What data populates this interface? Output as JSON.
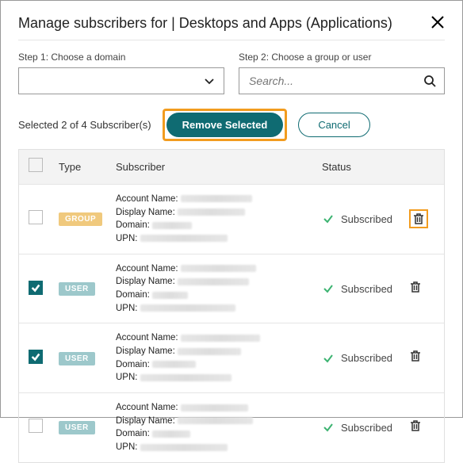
{
  "header": {
    "title": "Manage subscribers for | Desktops and Apps (Applications)"
  },
  "steps": {
    "domain_label": "Step 1: Choose a domain",
    "search_label": "Step 2: Choose a group or user",
    "search_placeholder": "Search..."
  },
  "actions": {
    "selected_text": "Selected 2 of 4 Subscriber(s)",
    "remove_label": "Remove Selected",
    "cancel_label": "Cancel"
  },
  "columns": {
    "type": "Type",
    "subscriber": "Subscriber",
    "status": "Status"
  },
  "detail_labels": {
    "account": "Account Name:",
    "display": "Display Name:",
    "domain": "Domain:",
    "upn": "UPN:"
  },
  "status_label": "Subscribed",
  "rows": [
    {
      "type_badge": "GROUP",
      "badge_class": "group",
      "checked": false,
      "trash_highlight": true
    },
    {
      "type_badge": "USER",
      "badge_class": "user",
      "checked": true,
      "trash_highlight": false
    },
    {
      "type_badge": "USER",
      "badge_class": "user",
      "checked": true,
      "trash_highlight": false
    },
    {
      "type_badge": "USER",
      "badge_class": "user",
      "checked": false,
      "trash_highlight": false
    }
  ]
}
